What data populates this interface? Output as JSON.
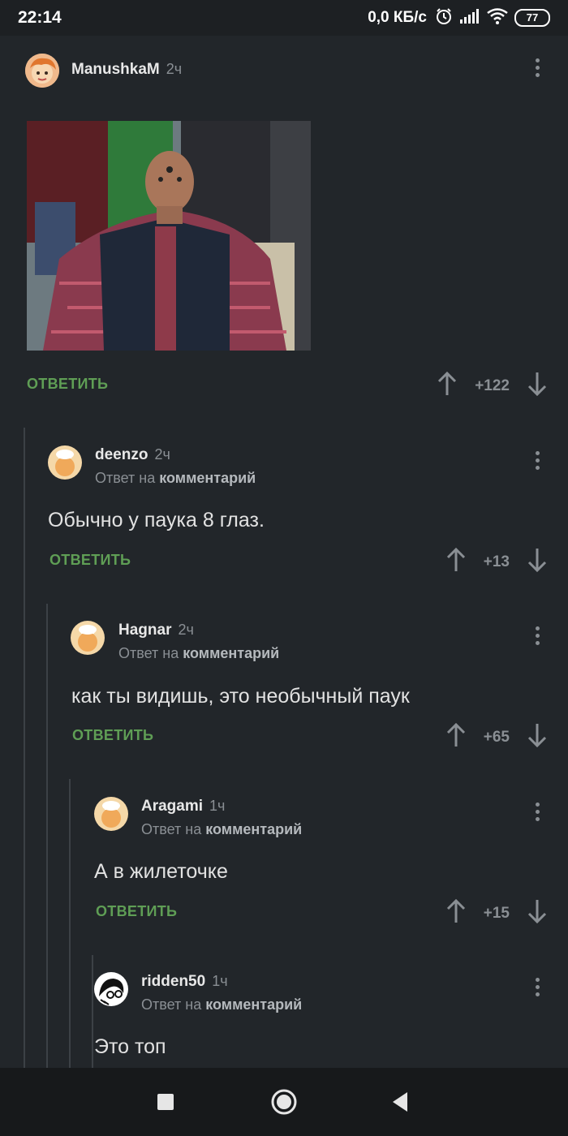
{
  "status_bar": {
    "time": "22:14",
    "speed": "0,0 КБ/с",
    "battery": "77"
  },
  "post": {
    "username": "ManushkaM",
    "time": "2ч",
    "answer_label": "ОТВЕТИТЬ",
    "score": "+122"
  },
  "comments": [
    {
      "username": "deenzo",
      "time": "2ч",
      "reply_prefix": "Ответ на",
      "reply_target": "комментарий",
      "text": "Обычно у паука 8 глаз.",
      "answer_label": "ОТВЕТИТЬ",
      "score": "+13"
    },
    {
      "username": "Hagnar",
      "time": "2ч",
      "reply_prefix": "Ответ на",
      "reply_target": "комментарий",
      "text": "как ты видишь, это необычный паук",
      "answer_label": "ОТВЕТИТЬ",
      "score": "+65"
    },
    {
      "username": "Aragami",
      "time": "1ч",
      "reply_prefix": "Ответ на",
      "reply_target": "комментарий",
      "text": "А в жилеточке",
      "answer_label": "ОТВЕТИТЬ",
      "score": "+15"
    },
    {
      "username": "ridden50",
      "time": "1ч",
      "reply_prefix": "Ответ на",
      "reply_target": "комментарий",
      "text": "Это топ"
    }
  ],
  "colors": {
    "background": "#22262a",
    "accent_green": "#5f9e55",
    "muted": "#8a8f94"
  },
  "icons": {
    "status": [
      "alarm-icon",
      "signal-icon",
      "wifi-icon",
      "battery-icon"
    ],
    "votes": [
      "arrow-up-icon",
      "arrow-down-icon"
    ],
    "nav": [
      "recents-square-icon",
      "home-circle-icon",
      "back-triangle-icon"
    ]
  }
}
